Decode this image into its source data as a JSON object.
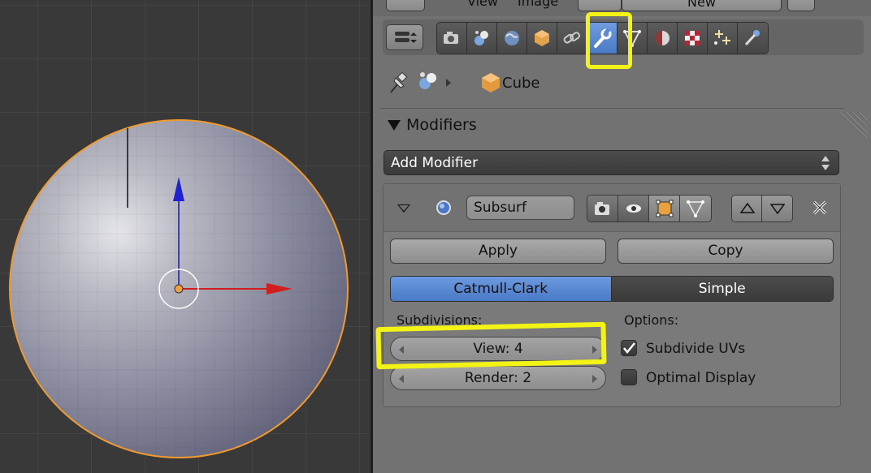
{
  "header": {
    "menu_view": "View",
    "menu_image": "Image",
    "new_button": "New"
  },
  "context_tabs": [
    {
      "icon": "render-camera-icon"
    },
    {
      "icon": "render-layers-icon"
    },
    {
      "icon": "scene-icon"
    },
    {
      "icon": "world-icon"
    },
    {
      "icon": "object-icon"
    },
    {
      "icon": "constraints-icon"
    },
    {
      "icon": "modifiers-wrench-icon",
      "active": true
    },
    {
      "icon": "object-data-icon"
    },
    {
      "icon": "material-icon"
    },
    {
      "icon": "texture-icon"
    },
    {
      "icon": "particles-icon"
    },
    {
      "icon": "physics-icon"
    }
  ],
  "breadcrumb": {
    "object_name": "Cube"
  },
  "modifiers_panel": {
    "title": "Modifiers",
    "add_modifier_label": "Add Modifier"
  },
  "modifier": {
    "name": "Subsurf",
    "apply_label": "Apply",
    "copy_label": "Copy",
    "type_options": [
      "Catmull-Clark",
      "Simple"
    ],
    "selected_type": "Catmull-Clark",
    "subdivisions_label": "Subdivisions:",
    "view_field": "View: 4",
    "render_field": "Render: 2",
    "options_label": "Options:",
    "subdivide_uvs_label": "Subdivide UVs",
    "subdivide_uvs_checked": true,
    "optimal_display_label": "Optimal Display",
    "optimal_display_checked": false
  },
  "colors": {
    "highlight": "#f3f316",
    "active_blue": "#5b88d2",
    "selection_orange": "#f0a040"
  }
}
